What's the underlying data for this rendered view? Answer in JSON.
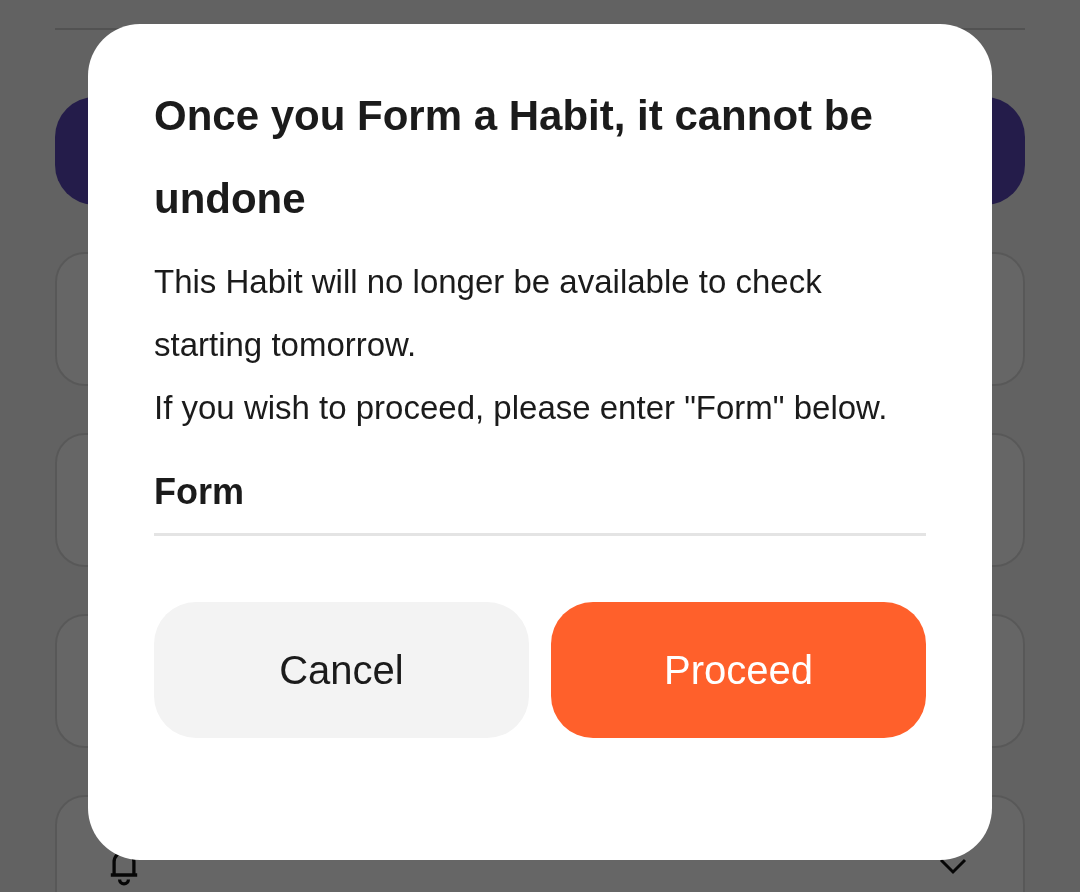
{
  "dialog": {
    "title": "Once you Form a Habit, it cannot be undone",
    "paragraphs": [
      "This Habit will no longer be available to check starting tomorrow.",
      "If you wish to proceed, please enter \"Form\" below."
    ],
    "input": {
      "value": "Form"
    },
    "buttons": [
      {
        "label": "Cancel",
        "kind": "secondary"
      },
      {
        "label": "Proceed",
        "kind": "primary"
      }
    ]
  }
}
